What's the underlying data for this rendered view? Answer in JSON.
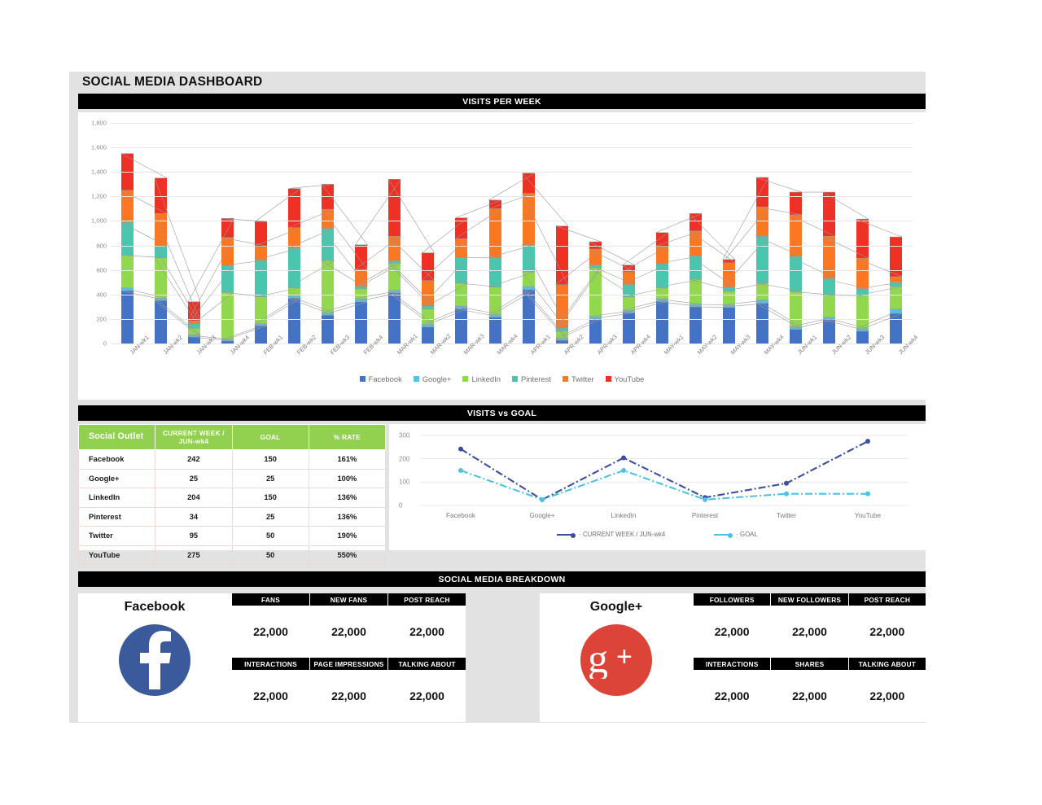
{
  "dashboard": {
    "title": "SOCIAL MEDIA DASHBOARD",
    "sections": {
      "visits_per_week": "VISITS PER WEEK",
      "visits_vs_goal": "VISITS vs GOAL",
      "social_media_breakdown": "SOCIAL MEDIA BREAKDOWN"
    }
  },
  "colors": {
    "facebook": "#4472c4",
    "googleplus": "#4fc3e8",
    "linkedin": "#92d84f",
    "pinterest": "#4ac6ae",
    "twitter": "#fb7722",
    "youtube": "#ee3124",
    "header_green": "#92d050",
    "band_black": "#000000",
    "current_week_line": "#3b4f9e",
    "goal_line": "#4ec3e0"
  },
  "chart_data": [
    {
      "type": "bar",
      "title": "VISITS PER WEEK",
      "stacked": true,
      "xlabel": "",
      "ylabel": "",
      "ylim": [
        0,
        1800
      ],
      "yticks": [
        "0",
        "200",
        "400",
        "600",
        "800",
        "1,000",
        "1,200",
        "1,400",
        "1,600",
        "1,800"
      ],
      "grid": true,
      "legend": "bottom",
      "categories": [
        "JAN-wk1",
        "JAN-wk2",
        "JAN-wk3",
        "JAN-wk4",
        "FEB-wk1",
        "FEB-wk2",
        "FEB-wk3",
        "FEB-wk4",
        "MAR-wk1",
        "MAR-wk2",
        "MAR-wk3",
        "MAR-wk4",
        "APR-wk1",
        "APR-wk2",
        "APR-wk3",
        "APR-wk4",
        "MAY-wk1",
        "MAY-wk2",
        "MAY-wk3",
        "MAY-wk4",
        "JUN-wk1",
        "JUN-wk2",
        "JUN-wk3",
        "JUN-wk4"
      ],
      "series": [
        {
          "name": "Facebook",
          "color": "#4472c4",
          "values": [
            430,
            350,
            55,
            20,
            145,
            370,
            230,
            340,
            415,
            135,
            285,
            215,
            440,
            25,
            200,
            250,
            345,
            300,
            295,
            330,
            115,
            195,
            100,
            245
          ]
        },
        {
          "name": "Google+",
          "color": "#4fc3e8",
          "values": [
            25,
            20,
            15,
            10,
            15,
            20,
            20,
            25,
            20,
            20,
            20,
            20,
            25,
            15,
            20,
            20,
            20,
            20,
            20,
            25,
            20,
            20,
            20,
            35
          ]
        },
        {
          "name": "LinkedIn",
          "color": "#92d84f",
          "values": [
            265,
            330,
            55,
            390,
            220,
            65,
            425,
            80,
            220,
            125,
            190,
            225,
            120,
            60,
            400,
            110,
            90,
            205,
            110,
            140,
            290,
            180,
            270,
            185
          ]
        },
        {
          "name": "Pinterest",
          "color": "#4ac6ae",
          "values": [
            270,
            90,
            35,
            215,
            300,
            325,
            265,
            20,
            20,
            25,
            205,
            240,
            220,
            25,
            20,
            100,
            195,
            190,
            35,
            380,
            285,
            135,
            55,
            35
          ]
        },
        {
          "name": "Twitter",
          "color": "#fb7722",
          "values": [
            260,
            270,
            25,
            230,
            115,
            165,
            155,
            140,
            200,
            210,
            155,
            400,
            420,
            355,
            130,
            105,
            145,
            205,
            200,
            240,
            340,
            345,
            250,
            45
          ]
        },
        {
          "name": "YouTube",
          "color": "#ee3124",
          "values": [
            300,
            290,
            155,
            155,
            200,
            320,
            205,
            200,
            465,
            225,
            170,
            70,
            165,
            480,
            60,
            55,
            110,
            140,
            25,
            240,
            185,
            360,
            320,
            325
          ]
        }
      ]
    },
    {
      "type": "line",
      "title": "VISITS vs GOAL",
      "ylim": [
        0,
        300
      ],
      "yticks": [
        "0",
        "100",
        "200",
        "300"
      ],
      "grid": true,
      "legend": "bottom",
      "categories": [
        "Facebook",
        "Google+",
        "LinkedIn",
        "Pinterest",
        "Twitter",
        "YouTube"
      ],
      "series": [
        {
          "name": "CURRENT WEEK / JUN-wk4",
          "color": "#3b4f9e",
          "values": [
            242,
            25,
            204,
            34,
            95,
            275
          ]
        },
        {
          "name": "GOAL",
          "color": "#4ec3e0",
          "values": [
            150,
            25,
            150,
            25,
            50,
            50
          ]
        }
      ]
    }
  ],
  "visits_table": {
    "headers": [
      "Social Outlet",
      "CURRENT WEEK / JUN-wk4",
      "GOAL",
      "% RATE"
    ],
    "rows": [
      {
        "outlet": "Facebook",
        "current": "242",
        "goal": "150",
        "rate": "161%"
      },
      {
        "outlet": "Google+",
        "current": "25",
        "goal": "25",
        "rate": "100%"
      },
      {
        "outlet": "LinkedIn",
        "current": "204",
        "goal": "150",
        "rate": "136%"
      },
      {
        "outlet": "Pinterest",
        "current": "34",
        "goal": "25",
        "rate": "136%"
      },
      {
        "outlet": "Twitter",
        "current": "95",
        "goal": "50",
        "rate": "190%"
      },
      {
        "outlet": "YouTube",
        "current": "275",
        "goal": "50",
        "rate": "550%"
      }
    ]
  },
  "breakdown": {
    "facebook": {
      "name": "Facebook",
      "logo": "facebook-logo",
      "metrics": [
        {
          "label": "FANS",
          "value": "22,000"
        },
        {
          "label": "NEW FANS",
          "value": "22,000"
        },
        {
          "label": "POST REACH",
          "value": "22,000"
        },
        {
          "label": "INTERACTIONS",
          "value": "22,000"
        },
        {
          "label": "PAGE IMPRESSIONS",
          "value": "22,000"
        },
        {
          "label": "TALKING ABOUT",
          "value": "22,000"
        }
      ]
    },
    "googleplus": {
      "name": "Google+",
      "logo": "googleplus-logo",
      "metrics": [
        {
          "label": "FOLLOWERS",
          "value": "22,000"
        },
        {
          "label": "NEW FOLLOWERS",
          "value": "22,000"
        },
        {
          "label": "POST REACH",
          "value": "22,000"
        },
        {
          "label": "INTERACTIONS",
          "value": "22,000"
        },
        {
          "label": "SHARES",
          "value": "22,000"
        },
        {
          "label": "TALKING ABOUT",
          "value": "22,000"
        }
      ]
    }
  }
}
